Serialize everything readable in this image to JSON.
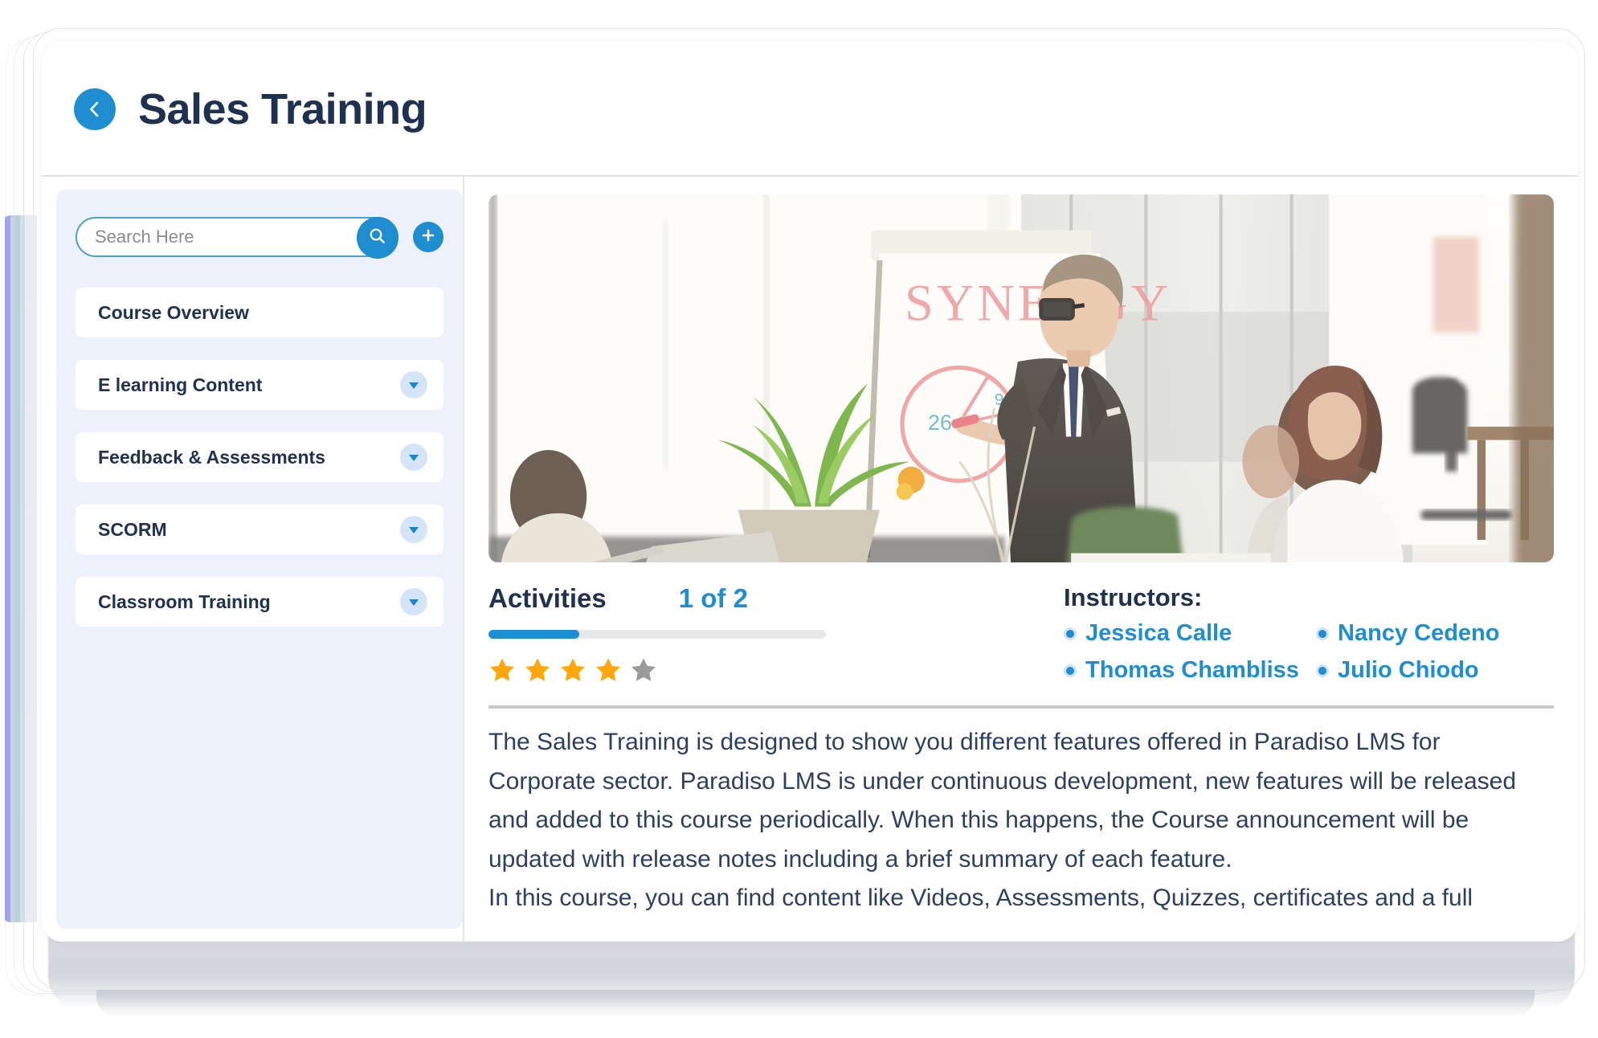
{
  "header": {
    "title": "Sales Training",
    "back_icon": "chevron-left-icon"
  },
  "sidebar": {
    "search": {
      "placeholder": "Search Here",
      "value": "",
      "search_icon": "search-icon",
      "add_icon": "plus-icon"
    },
    "items": [
      {
        "label": "Course Overview",
        "expandable": false
      },
      {
        "label": "E learning Content",
        "expandable": true
      },
      {
        "label": "Feedback & Assessments",
        "expandable": true
      },
      {
        "label": "SCORM",
        "expandable": true
      },
      {
        "label": "Classroom Training",
        "expandable": true
      }
    ]
  },
  "main": {
    "hero": {
      "alt": "Business trainer presenting at a flipchart in a bright office",
      "whiteboard_text": "SYNERGY"
    },
    "activities": {
      "title": "Activities",
      "count_label": "1 of 2",
      "progress_percent": 27,
      "rating": 4,
      "rating_max": 5
    },
    "instructors": {
      "title": "Instructors:",
      "names": [
        "Jessica Calle",
        "Nancy Cedeno",
        "Thomas Chambliss",
        "Julio Chiodo"
      ]
    },
    "description": {
      "paragraph_1": "The Sales Training is designed to show you different features offered in Paradiso LMS for Corporate sector. Paradiso LMS is under continuous development, new features will be released and added to this course periodically. When this happens, the Course announcement will be updated with release notes including a brief summary of each feature.",
      "paragraph_2": "In this course, you can find content like Videos, Assessments, Quizzes, certificates and a full"
    }
  },
  "colors": {
    "accent_blue": "#1e8ed0",
    "title_navy": "#1f3150",
    "sidebar_bg": "#edf1fb",
    "star_filled": "#FFA70B",
    "star_empty": "#9b9b9b",
    "progress_fill": "#1b8ed4"
  }
}
